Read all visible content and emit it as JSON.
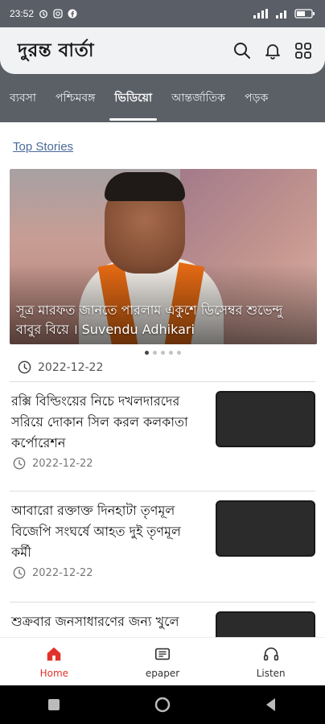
{
  "status_bar": {
    "time": "23:52"
  },
  "app": {
    "title": "দুরন্ত বার্তা"
  },
  "tabs": [
    {
      "label": "ব্যবসা"
    },
    {
      "label": "পশ্চিমবঙ্গ"
    },
    {
      "label": "ভিডিয়ো"
    },
    {
      "label": "আন্তর্জাতিক"
    },
    {
      "label": "পড়ক"
    }
  ],
  "section": {
    "title": "Top Stories"
  },
  "hero": {
    "caption": "সূত্র মারফত জানতে পারলাম একুশে ডিসেম্বর শুভেন্দু বাবুর বিয়ে । Suvendu Adhikari",
    "date": "2022-12-22",
    "carousel": {
      "count": 5,
      "active_index": 0
    }
  },
  "news": [
    {
      "title": "রক্সি বিল্ডিংয়ের নিচে দখলদারদের সরিয়ে দোকান সিল করল কলকাতা কর্পোরেশন",
      "date": "2022-12-22"
    },
    {
      "title": "আবারো রক্তাক্ত দিনহাটা তৃণমূল বিজেপি সংঘর্ষে আহত দুই তৃণমূল কর্মী",
      "date": "2022-12-22"
    },
    {
      "title": "শুক্রবার জনসাধারণের জন্য খুলে",
      "date": ""
    }
  ],
  "bottom_nav": [
    {
      "label": "Home",
      "icon": "home-icon",
      "active": true
    },
    {
      "label": "epaper",
      "icon": "epaper-icon",
      "active": false
    },
    {
      "label": "Listen",
      "icon": "headphones-icon",
      "active": false
    }
  ],
  "colors": {
    "accent": "#e0322b",
    "header_bg": "#5b5f66",
    "section_title": "#4a6a9a"
  }
}
